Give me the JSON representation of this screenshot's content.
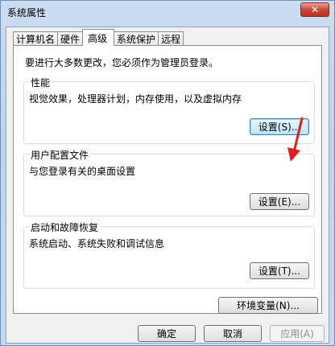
{
  "window": {
    "title": "系统属性",
    "close_label": "✕"
  },
  "tabs": [
    {
      "label": "计算机名",
      "active": false
    },
    {
      "label": "硬件",
      "active": false
    },
    {
      "label": "高级",
      "active": true
    },
    {
      "label": "系统保护",
      "active": false
    },
    {
      "label": "远程",
      "active": false
    }
  ],
  "advanced": {
    "intro": "要进行大多数更改，您必须作为管理员登录。",
    "performance": {
      "title": "性能",
      "description": "视觉效果，处理器计划，内存使用，以及虚拟内存",
      "button": "设置(S)..."
    },
    "user_profiles": {
      "title": "用户配置文件",
      "description": "与您登录有关的桌面设置",
      "button": "设置(E)..."
    },
    "startup_recovery": {
      "title": "启动和故障恢复",
      "description": "系统启动、系统失败和调试信息",
      "button": "设置(T)..."
    },
    "env_vars_button": "环境变量(N)..."
  },
  "footer": {
    "ok": "确定",
    "cancel": "取消",
    "apply": "应用(A)"
  },
  "colors": {
    "annotation_arrow": "#e02020"
  }
}
